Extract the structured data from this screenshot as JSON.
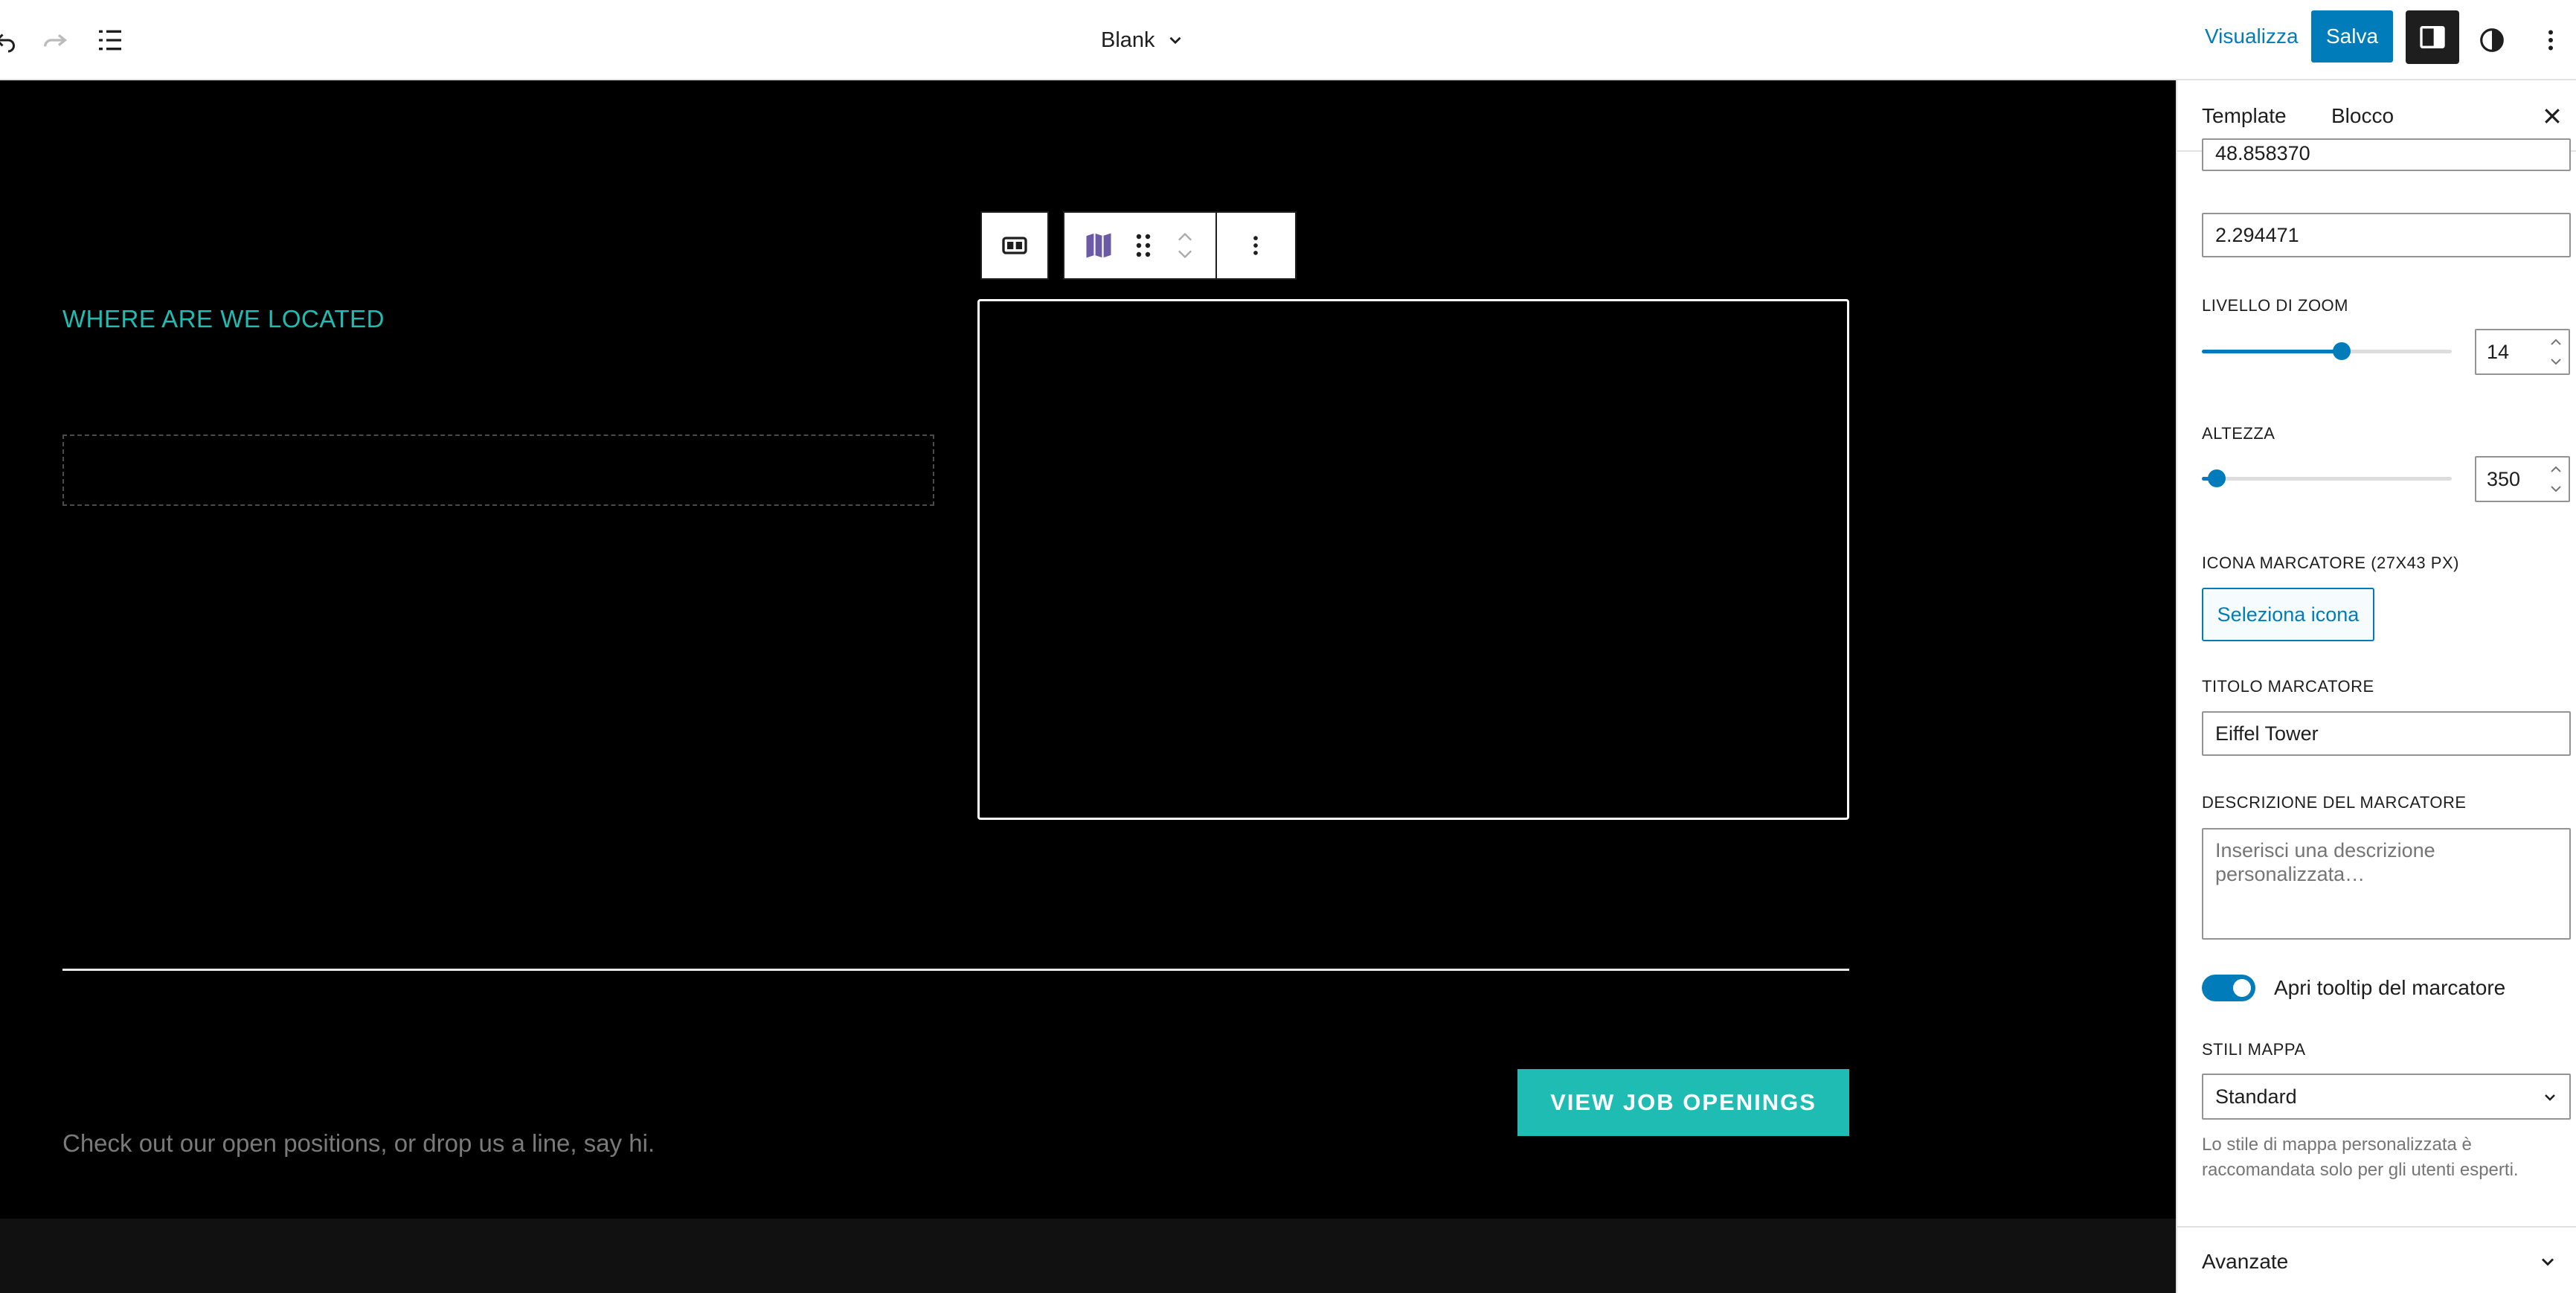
{
  "topbar": {
    "document_title": "Blank",
    "preview_label": "Visualizza",
    "save_label": "Salva"
  },
  "canvas": {
    "section_heading": "WHERE ARE WE LOCATED",
    "cta_label": "VIEW JOB OPENINGS",
    "footer_text": "Check out our open positions, or drop us a line, say hi."
  },
  "sidebar": {
    "tabs": [
      {
        "label": "Template",
        "active": false
      },
      {
        "label": "Blocco",
        "active": true
      }
    ],
    "latitude_value": "48.858370",
    "longitude_value": "2.294471",
    "zoom": {
      "label": "LIVELLO DI ZOOM",
      "value": "14",
      "fill_percent": 56
    },
    "height": {
      "label": "ALTEZZA",
      "value": "350",
      "fill_percent": 6
    },
    "marker_icon": {
      "label": "ICONA MARCATORE (27X43 PX)",
      "button_label": "Seleziona icona"
    },
    "marker_title": {
      "label": "TITOLO MARCATORE",
      "value": "Eiffel Tower"
    },
    "marker_description": {
      "label": "DESCRIZIONE DEL MARCATORE",
      "placeholder": "Inserisci una descrizione personalizzata…"
    },
    "tooltip_toggle": {
      "label": "Apri tooltip del marcatore",
      "checked": true
    },
    "map_styles": {
      "label": "STILI MAPPA",
      "selected": "Standard",
      "help": "Lo stile di mappa personalizzata è raccomandata solo per gli utenti esperti."
    },
    "advanced_label": "Avanzate"
  },
  "colors": {
    "accent": "#007cba",
    "teal": "#1fbcb3",
    "map_icon": "#6b5aa5"
  },
  "icons": {
    "undo": "undo-icon",
    "redo": "redo-icon",
    "list_view": "list-view-icon",
    "settings": "sidebar-settings-icon",
    "styles": "contrast-icon",
    "options": "more-vertical-icon",
    "map": "map-icon",
    "drag": "drag-handle-icon",
    "columns": "columns-icon"
  }
}
